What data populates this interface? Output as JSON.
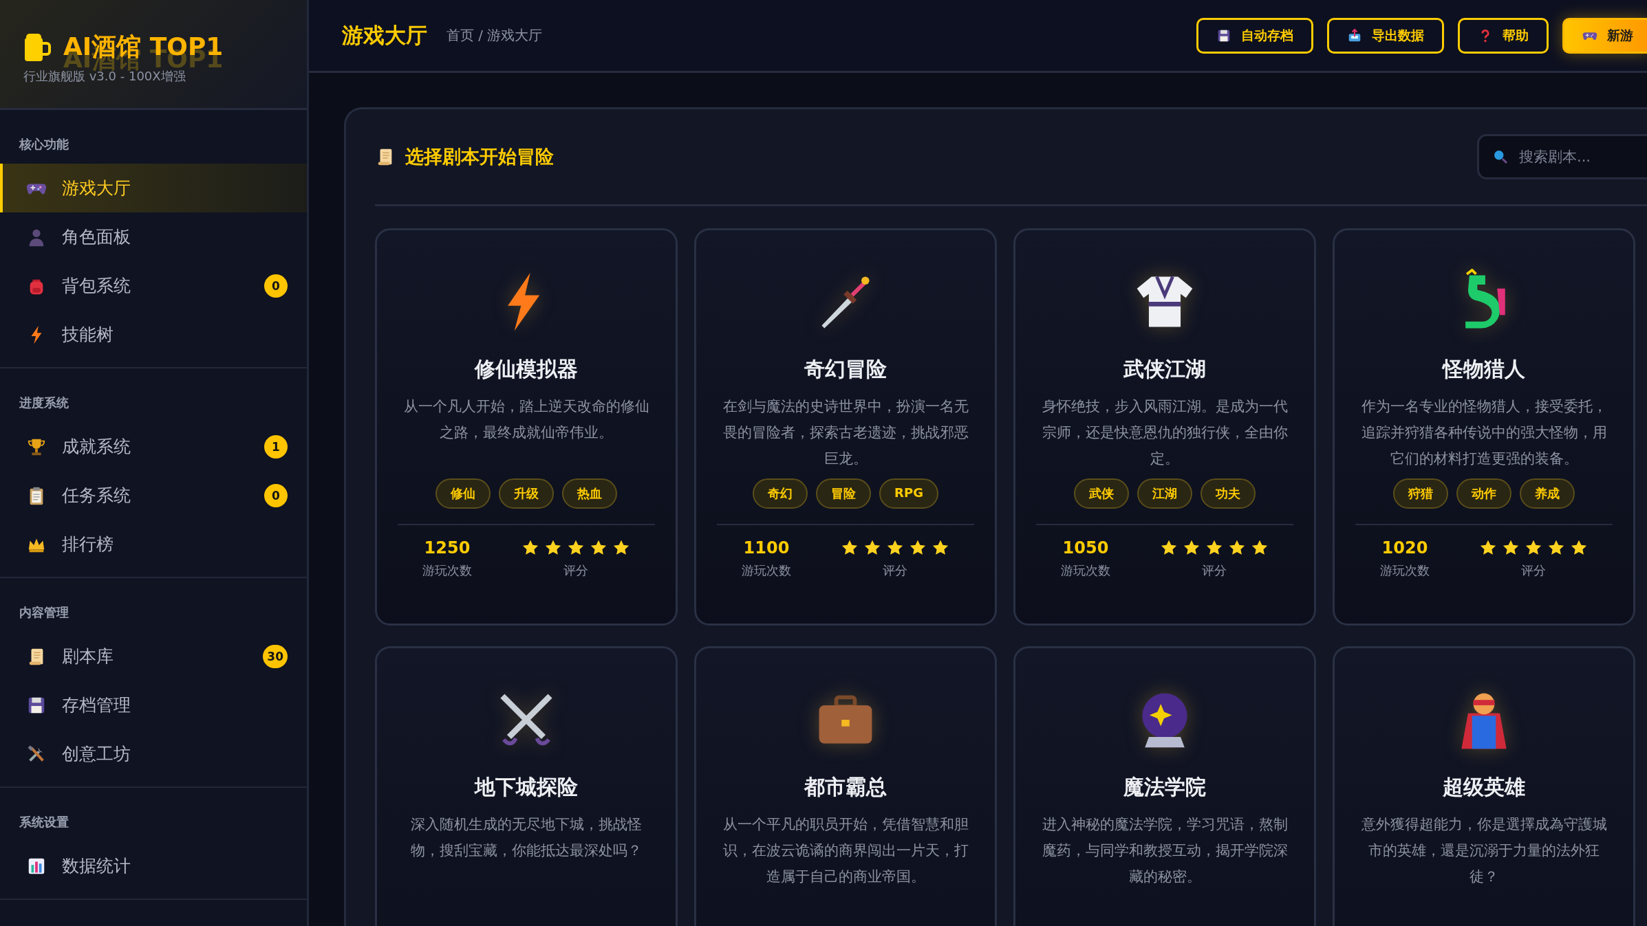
{
  "sidebar": {
    "logo": {
      "title": "AI酒馆 TOP1",
      "subtitle": "行业旗舰版 v3.0 - 100X增强"
    },
    "sections": [
      {
        "title": "核心功能",
        "items": [
          {
            "label": "游戏大厅",
            "selected": true
          },
          {
            "label": "角色面板",
            "selected": false
          },
          {
            "label": "背包系统",
            "selected": false,
            "badge": "0"
          },
          {
            "label": "技能树",
            "selected": false
          }
        ]
      },
      {
        "title": "进度系统",
        "items": [
          {
            "label": "成就系统",
            "selected": false,
            "badge": "1"
          },
          {
            "label": "任务系统",
            "selected": false,
            "badge": "0"
          },
          {
            "label": "排行榜",
            "selected": false
          }
        ]
      },
      {
        "title": "内容管理",
        "items": [
          {
            "label": "剧本库",
            "selected": false,
            "badge": "30"
          },
          {
            "label": "存档管理",
            "selected": false
          },
          {
            "label": "创意工坊",
            "selected": false
          }
        ]
      },
      {
        "title": "系统设置",
        "items": [
          {
            "label": "数据统计",
            "selected": false
          }
        ]
      }
    ]
  },
  "header": {
    "title": "游戏大厅",
    "breadcrumb": "首页 / 游戏大厅",
    "buttons": [
      {
        "label": "自动存档",
        "kind": "outline"
      },
      {
        "label": "导出数据",
        "kind": "outline"
      },
      {
        "label": "帮助",
        "kind": "outline"
      },
      {
        "label": "新游",
        "kind": "primary"
      }
    ]
  },
  "panel": {
    "title": "选择剧本开始冒险",
    "search": {
      "placeholder": "搜索剧本..."
    },
    "cards": [
      {
        "title": "修仙模拟器",
        "description": "从一个凡人开始，踏上逆天改命的修仙之路，最终成就仙帝伟业。",
        "tags": [
          "修仙",
          "升级",
          "热血"
        ],
        "plays": "1250",
        "plays_label": "游玩次数",
        "stars": 5,
        "rating_label": "评分"
      },
      {
        "title": "奇幻冒险",
        "description": "在剑与魔法的史诗世界中，扮演一名无畏的冒险者，探索古老遗迹，挑战邪恶巨龙。",
        "tags": [
          "奇幻",
          "冒险",
          "RPG"
        ],
        "plays": "1100",
        "plays_label": "游玩次数",
        "stars": 5,
        "rating_label": "评分"
      },
      {
        "title": "武侠江湖",
        "description": "身怀绝技，步入风雨江湖。是成为一代宗师，还是快意恩仇的独行侠，全由你定。",
        "tags": [
          "武侠",
          "江湖",
          "功夫"
        ],
        "plays": "1050",
        "plays_label": "游玩次数",
        "stars": 5,
        "rating_label": "评分"
      },
      {
        "title": "怪物猎人",
        "description": "作为一名专业的怪物猎人，接受委托，追踪并狩猎各种传说中的强大怪物，用它们的材料打造更强的装备。",
        "tags": [
          "狩猎",
          "动作",
          "养成"
        ],
        "plays": "1020",
        "plays_label": "游玩次数",
        "stars": 5,
        "rating_label": "评分"
      },
      {
        "title": "地下城探险",
        "description": "深入随机生成的无尽地下城，挑战怪物，搜刮宝藏，你能抵达最深处吗？"
      },
      {
        "title": "都市霸总",
        "description": "从一个平凡的职员开始，凭借智慧和胆识，在波云诡谲的商界闯出一片天，打造属于自己的商业帝国。"
      },
      {
        "title": "魔法学院",
        "description": "进入神秘的魔法学院，学习咒语，熬制魔药，与同学和教授互动，揭开学院深藏的秘密。"
      },
      {
        "title": "超级英雄",
        "description": "意外獲得超能力，你是選擇成為守護城市的英雄，還是沉溺于力量的法外狂徒？"
      }
    ]
  }
}
